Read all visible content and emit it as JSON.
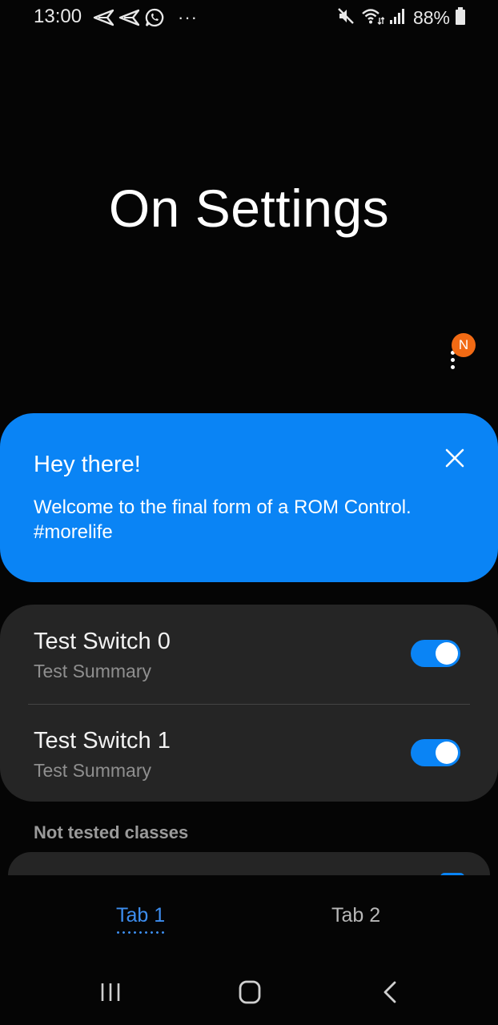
{
  "status_bar": {
    "time": "13:00",
    "left_icons": [
      "send-icon",
      "send-icon",
      "whatsapp-icon",
      "more-horizontal-icon"
    ],
    "more": "···",
    "right_icons": [
      "mute-icon",
      "wifi-icon",
      "signal-icon",
      "battery-icon"
    ],
    "battery_percent": "88%"
  },
  "page": {
    "title": "On Settings",
    "notification_badge": "N"
  },
  "welcome_card": {
    "title": "Hey there!",
    "message": "Welcome to the final form of a ROM Control. #morelife",
    "color": "#0a84f5"
  },
  "switches": [
    {
      "title": "Test Switch 0",
      "summary": "Test Summary",
      "checked": true
    },
    {
      "title": "Test Switch 1",
      "summary": "Test Summary",
      "checked": true
    }
  ],
  "section": {
    "header": "Not tested classes"
  },
  "tabs": [
    {
      "label": "Tab 1",
      "selected": true
    },
    {
      "label": "Tab 2",
      "selected": false
    }
  ],
  "colors": {
    "accent": "#0a84f5",
    "background": "#050505",
    "card": "#252525",
    "badge": "#f26a14"
  }
}
